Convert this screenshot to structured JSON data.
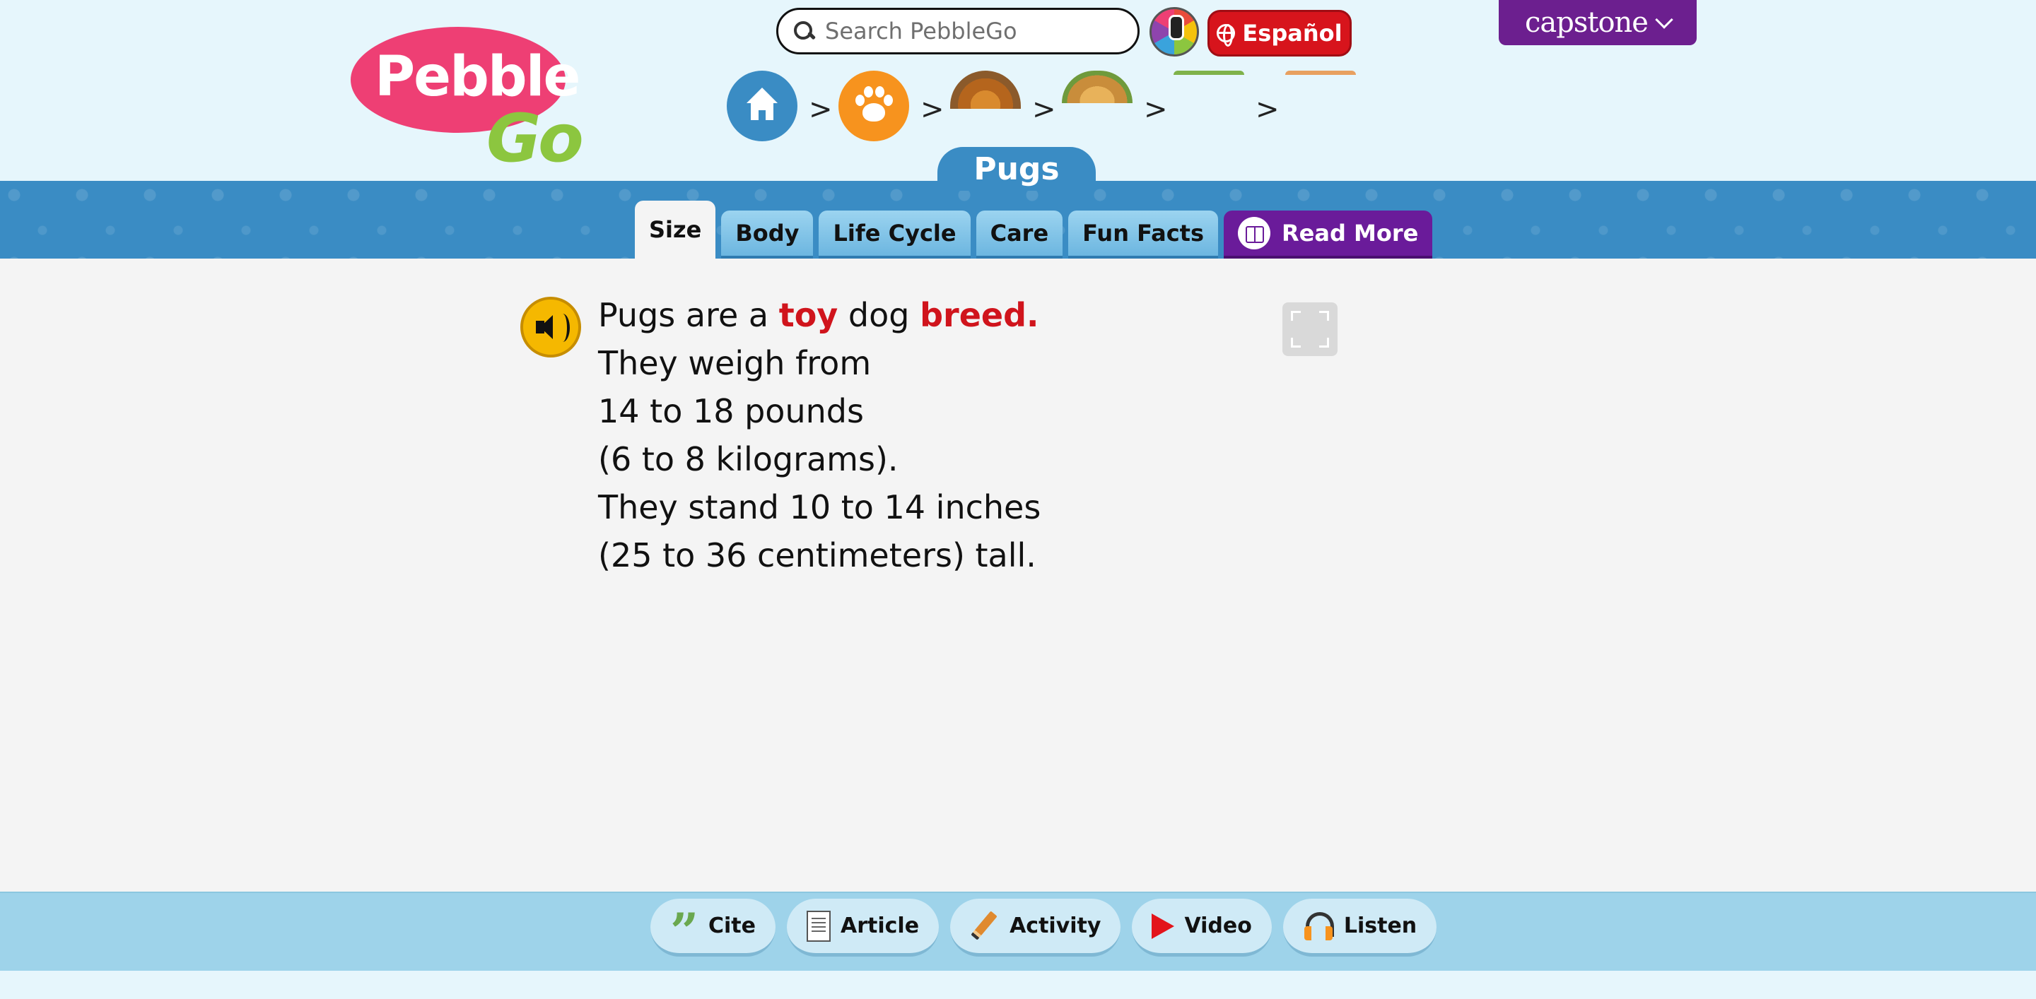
{
  "header": {
    "search": {
      "placeholder": "Search PebbleGo"
    },
    "language_button": "Español",
    "brand_menu": "capstone",
    "logo": {
      "line1": "Pebble",
      "line2": "Go"
    }
  },
  "breadcrumb": {
    "items": [
      {
        "name": "home-icon"
      },
      {
        "name": "paw-icon"
      },
      {
        "name": "dogs-image"
      },
      {
        "name": "breed-image"
      },
      {
        "name": "crumb-image-4"
      },
      {
        "name": "crumb-image-5"
      }
    ],
    "separator": ">"
  },
  "page": {
    "title": "Pugs",
    "tabs": [
      "Size",
      "Body",
      "Life Cycle",
      "Care",
      "Fun Facts"
    ],
    "active_tab": "Size",
    "read_more": "Read More"
  },
  "content": {
    "line1": {
      "a": "Pugs are a ",
      "b": "toy",
      "c": " dog ",
      "d": "breed."
    },
    "line2": "They weigh from",
    "line3": "14 to 18 pounds",
    "line4": "(6 to 8 kilograms).",
    "line5": "They stand 10 to 14 inches",
    "line6": "(25 to 36 centimeters) tall."
  },
  "bottom_tools": [
    "Cite",
    "Article",
    "Activity",
    "Video",
    "Listen"
  ],
  "colors": {
    "header_bg": "#e6f6fc",
    "band_blue": "#3a8cc4",
    "espanol_red": "#d7141c",
    "capstone_purple": "#6c1f8f",
    "read_more_purple": "#6a1b9a",
    "highlight_red": "#d0141c",
    "bottom_bar": "#9ed3ea"
  }
}
